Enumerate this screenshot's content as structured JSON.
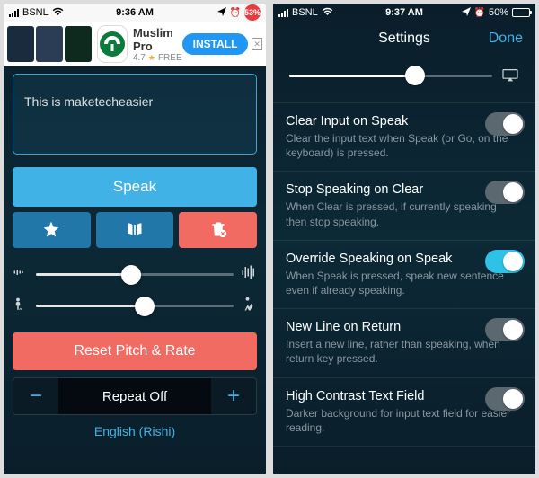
{
  "left": {
    "status": {
      "carrier": "BSNL",
      "time": "9:36 AM",
      "battery_pct": "53%"
    },
    "ad": {
      "title": "Muslim Pro",
      "rating": "4.7",
      "star": "★",
      "price": "FREE",
      "install": "INSTALL",
      "close": "✕"
    },
    "text_value": "This is maketecheasier",
    "speak": "Speak",
    "reset": "Reset Pitch & Rate",
    "repeat_minus": "−",
    "repeat_label": "Repeat Off",
    "repeat_plus": "+",
    "language": "English (Rishi)",
    "pitch_pct": 48,
    "rate_pct": 55
  },
  "right": {
    "status": {
      "carrier": "BSNL",
      "time": "9:37 AM",
      "battery_txt": "50%"
    },
    "nav": {
      "title": "Settings",
      "done": "Done"
    },
    "volume_pct": 62,
    "items": [
      {
        "title": "Clear Input on Speak",
        "desc": "Clear the input text when Speak (or Go, on the keyboard) is pressed.",
        "on": false
      },
      {
        "title": "Stop Speaking on Clear",
        "desc": "When Clear is pressed, if currently speaking then stop speaking.",
        "on": false
      },
      {
        "title": "Override Speaking on Speak",
        "desc": "When Speak is pressed, speak new sentence even if already speaking.",
        "on": true
      },
      {
        "title": "New Line on Return",
        "desc": "Insert a new line, rather than speaking, when return key pressed.",
        "on": false
      },
      {
        "title": "High Contrast Text Field",
        "desc": "Darker background for input text field for easier reading.",
        "on": false
      }
    ]
  }
}
